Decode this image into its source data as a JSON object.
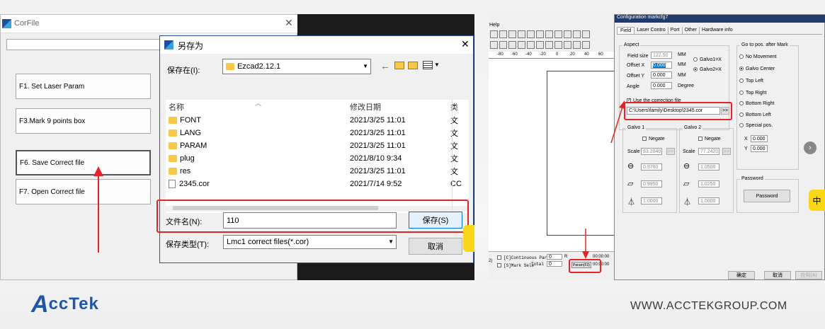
{
  "corfile": {
    "title": "CorFile",
    "buttons": [
      "F1. Set Laser Param",
      "F3.Mark 9 points box",
      "F6. Save Correct file",
      "F7. Open Correct file"
    ]
  },
  "saveas": {
    "title": "另存为",
    "save_in_label": "保存在(I):",
    "save_in_value": "Ezcad2.12.1",
    "col_name": "名称",
    "col_date": "修改日期",
    "col_type": "类",
    "files": [
      {
        "name": "FONT",
        "date": "2021/3/25 11:01",
        "type": "文",
        "icon": "folder"
      },
      {
        "name": "LANG",
        "date": "2021/3/25 11:01",
        "type": "文",
        "icon": "folder"
      },
      {
        "name": "PARAM",
        "date": "2021/3/25 11:01",
        "type": "文",
        "icon": "folder"
      },
      {
        "name": "plug",
        "date": "2021/8/10 9:34",
        "type": "文",
        "icon": "folder"
      },
      {
        "name": "res",
        "date": "2021/3/25 11:01",
        "type": "文",
        "icon": "folder"
      },
      {
        "name": "2345.cor",
        "date": "2021/7/14 9:52",
        "type": "CC",
        "icon": "file"
      }
    ],
    "filename_label": "文件名(N):",
    "filename_value": "110",
    "save_button": "保存(S)",
    "filetype_label": "保存类型(T):",
    "filetype_value": "Lmc1 correct files(*.cor)",
    "cancel_button": "取消"
  },
  "ezcad": {
    "menu_help": "Help",
    "ruler_labels": [
      "-80",
      "-60",
      "-40",
      "-20",
      "0",
      "20",
      "40",
      "60"
    ],
    "status": {
      "continuous_part": "[C]Continuous Part",
      "mark_sele": "[S]Mark Sele",
      "total": "Total",
      "part_value": "0",
      "total_value": "0",
      "r_label": "R",
      "param_button": "Param(F3)",
      "time1": "00:00:00",
      "time2": "00:00:00",
      "row_label": "2)"
    }
  },
  "config": {
    "title": "Configuration markcfg7",
    "tabs": [
      "Field",
      "Laser Contro",
      "Port",
      "Other",
      "Hardware info"
    ],
    "aspect_label": "Aspect",
    "field_size_label": "Field size",
    "field_size": "122.50",
    "offset_x_label": "Offset X",
    "offset_x": "0.000",
    "offset_y_label": "Offset Y",
    "offset_y": "0.000",
    "angle_label": "Angle",
    "angle": "0.000",
    "unit_mm": "MM",
    "unit_degree": "Degree",
    "galvo1x": "Galvo1=X",
    "galvo2x": "Galvo2=X",
    "use_correction": "Use the correction file",
    "correction_path": "C:\\Users\\family\\Desktop\\2345.cor",
    "browse": ">>",
    "galvo1_label": "Galvo 1",
    "galvo2_label": "Galvo 2",
    "negate": "Negate",
    "scale_label": "Scale",
    "g1_scale": "83.2040",
    "g2_scale": "77.2420",
    "g1_vals": [
      "0.9760",
      "0.9950",
      "1.0000"
    ],
    "g2_vals": [
      "1.0500",
      "1.0250",
      "1.0000"
    ],
    "go_to_pos": "Go to pos. after Mark",
    "positions": [
      "No Movement",
      "Galvo Center",
      "Top Left",
      "Top Right",
      "Bottom Right",
      "Bottom Left",
      "Special pos."
    ],
    "sp_x_label": "X",
    "sp_x": "0.000",
    "sp_y_label": "Y",
    "sp_y": "0.000",
    "password_group": "Password",
    "password_button": "Password",
    "ok": "确定",
    "cancel": "取消",
    "apply": "应用(A)"
  },
  "ime_char": "中",
  "footer": {
    "brand_a": "A",
    "brand_rest": "ccTek",
    "website": "WWW.ACCTEKGROUP.COM"
  },
  "colors": {
    "accent_red": "#e0262b",
    "brand_blue": "#1f56a8",
    "dialog_title_blue": "#2b579a"
  }
}
